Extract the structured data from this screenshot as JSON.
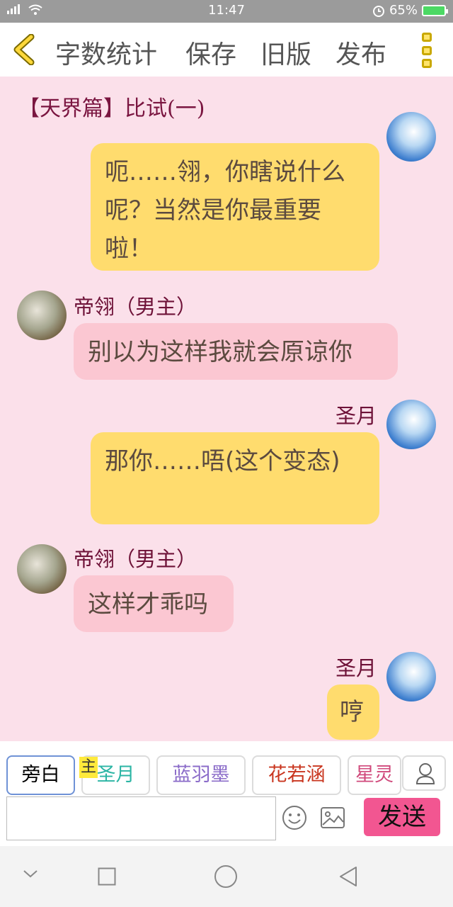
{
  "status": {
    "time": "11:47",
    "battery": "65%"
  },
  "toolbar": {
    "word_count": "字数统计",
    "save": "保存",
    "old_version": "旧版",
    "publish": "发布"
  },
  "chapter_title": "【天界篇】比试(一)",
  "messages": [
    {
      "text": "呃……翎，你瞎说什么呢？当然是你最重要啦！"
    },
    {
      "speaker": "帝翎（男主）",
      "text": "别以为这样我就会原谅你"
    },
    {
      "speaker": "圣月",
      "text": "那你……唔(这个变态)"
    },
    {
      "speaker": "帝翎（男主）",
      "text": "这样才乖吗"
    },
    {
      "speaker": "圣月",
      "text": "哼"
    }
  ],
  "roles": [
    {
      "label": "旁白",
      "color": "#555555"
    },
    {
      "label": "圣月",
      "color": "#2bb5a4"
    },
    {
      "label": "蓝羽墨",
      "color": "#8b6cc9"
    },
    {
      "label": "花若涵",
      "color": "#c9361f"
    },
    {
      "label": "星灵",
      "color": "#d04a7c"
    }
  ],
  "main_badge": "主",
  "send_label": "发送",
  "colors": {
    "accent_send": "#f25691",
    "bubble_yellow": "#ffdc6e",
    "bubble_pink": "#fbc7d2",
    "background": "#fbe0ea"
  },
  "icons": [
    "back-chevron-icon",
    "more-dots-icon",
    "user-icon",
    "emoji-icon",
    "image-icon",
    "nav-down-icon",
    "nav-square-icon",
    "nav-circle-icon",
    "nav-triangle-icon"
  ]
}
